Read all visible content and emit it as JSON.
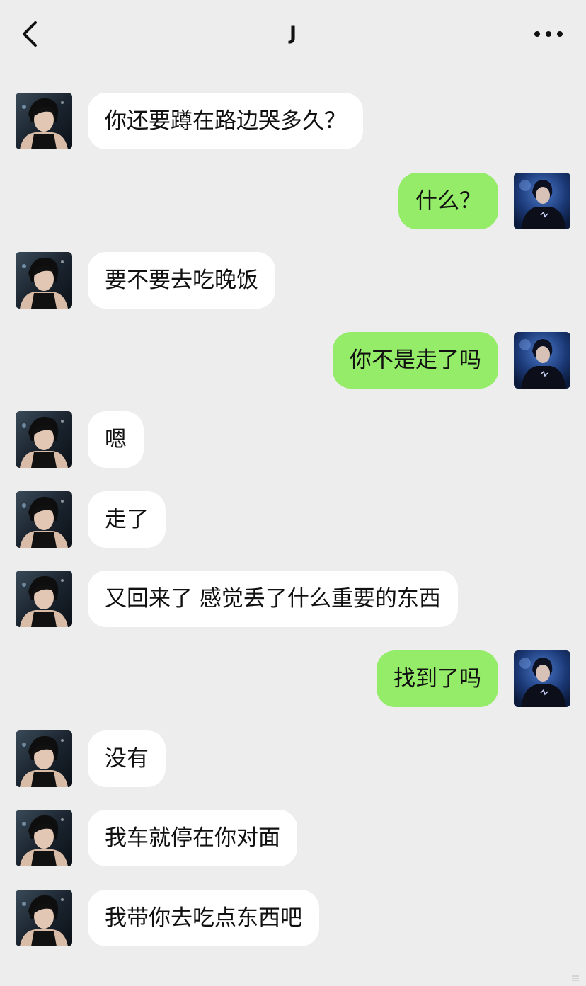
{
  "header": {
    "title": "J",
    "back_icon": "chevron-left-icon",
    "more_icon": "ellipsis-icon"
  },
  "colors": {
    "background": "#ededed",
    "incoming_bubble": "#ffffff",
    "outgoing_bubble": "#95ec69",
    "text": "#111111"
  },
  "messages": [
    {
      "side": "left",
      "text": "你还要蹲在路边哭多久？"
    },
    {
      "side": "right",
      "text": "什么？"
    },
    {
      "side": "left",
      "text": "要不要去吃晚饭"
    },
    {
      "side": "right",
      "text": "你不是走了吗"
    },
    {
      "side": "left",
      "text": "嗯"
    },
    {
      "side": "left",
      "text": "走了"
    },
    {
      "side": "left",
      "text": "又回来了 感觉丢了什么重要的东西"
    },
    {
      "side": "right",
      "text": "找到了吗"
    },
    {
      "side": "left",
      "text": "没有"
    },
    {
      "side": "left",
      "text": "我车就停在你对面"
    },
    {
      "side": "left",
      "text": "我带你去吃点东西吧"
    }
  ]
}
